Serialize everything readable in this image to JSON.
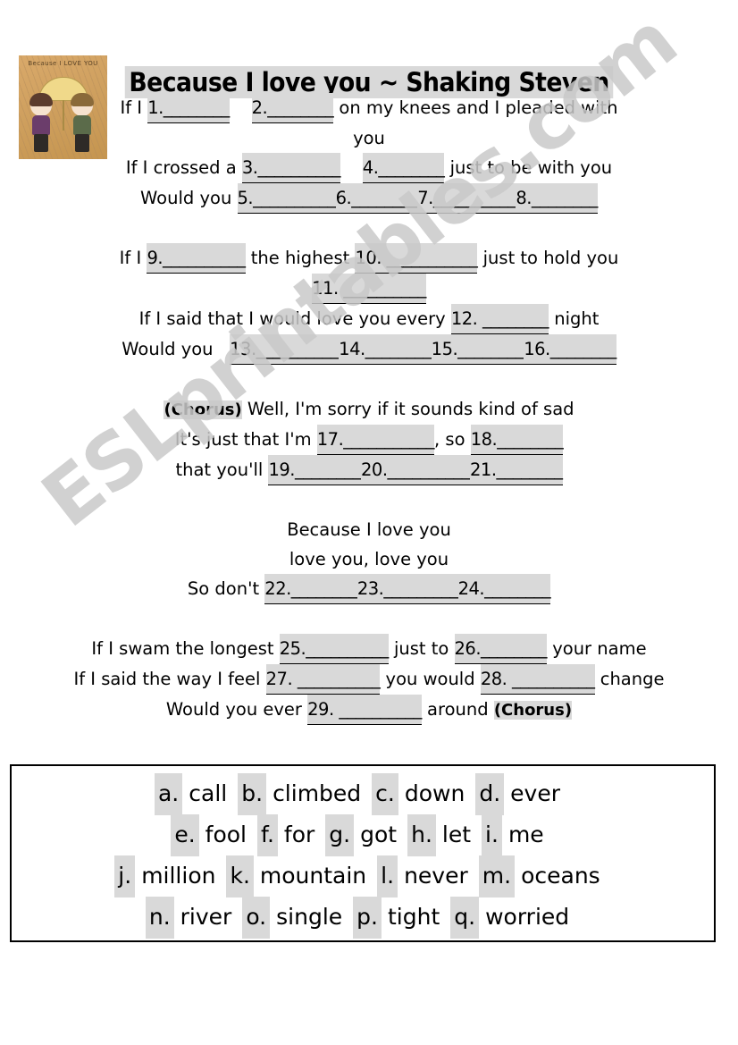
{
  "worksheet": {
    "title": "Because I love you ~ Shaking Steven",
    "cover_caption": "Because I LOVE YOU",
    "watermark": "ESLprintables.com"
  },
  "lyrics": {
    "verse1": {
      "line1_a": "If I ",
      "line1_b": "1.________",
      "line1_c": "2.________",
      "line1_d": " on my knees and I pleaded with",
      "line2": "you",
      "line3_a": "If I crossed a ",
      "line3_b": "3.__________",
      "line3_c": "4.________",
      "line3_d": " just to be with you",
      "line4_a": "Would you ",
      "line4_b": "5.__________",
      "line4_c": "6.________",
      "line4_d": "7.__________",
      "line4_e": "8.________"
    },
    "verse2": {
      "line1_a": "If I ",
      "line1_b": "9.__________",
      "line1_c": " the highest ",
      "line1_d": "10. ___________",
      "line1_e": " just to hold you",
      "line2": "11. __________",
      "line3_a": "If I said that I would love you every ",
      "line3_b": "12. ________",
      "line3_c": " night",
      "line4_a": "Would you ",
      "line4_b": "13.__________",
      "line4_c": "14.________",
      "line4_d": "15.________",
      "line4_e": "16.________"
    },
    "chorus": {
      "tag": "(Chorus)",
      "line1": " Well, I'm sorry if it sounds kind of sad",
      "line2_a": "It's just that I'm ",
      "line2_b": "17.___________",
      "line2_c": ", so ",
      "line2_d": "18.________",
      "line3_a": "that you'll ",
      "line3_b": "19.________",
      "line3_c": "20.__________",
      "line3_d": "21.________"
    },
    "refrain": {
      "line1": "Because I love you",
      "line2": "love you, love you",
      "line3_a": "So don't ",
      "line3_b": "22.________",
      "line3_c": "23._________",
      "line3_d": "24.________"
    },
    "verse3": {
      "line1_a": "If I swam the longest ",
      "line1_b": "25.__________",
      "line1_c": " just to ",
      "line1_d": "26.________",
      "line1_e": " your name",
      "line2_a": "If I said the way I feel ",
      "line2_b": "27. __________",
      "line2_c": " you would ",
      "line2_d": "28. __________",
      "line2_e": " change",
      "line3_a": "Would you ever ",
      "line3_b": "29. __________",
      "line3_c": " around ",
      "line3_d": "(Chorus)"
    }
  },
  "word_bank": {
    "rows": [
      [
        {
          "letter": "a.",
          "word": "call"
        },
        {
          "letter": "b.",
          "word": "climbed"
        },
        {
          "letter": "c.",
          "word": "down"
        },
        {
          "letter": "d.",
          "word": "ever"
        }
      ],
      [
        {
          "letter": "e.",
          "word": "fool"
        },
        {
          "letter": "f.",
          "word": "for"
        },
        {
          "letter": "g.",
          "word": "got"
        },
        {
          "letter": "h.",
          "word": "let"
        },
        {
          "letter": "i.",
          "word": "me"
        }
      ],
      [
        {
          "letter": "j.",
          "word": "million"
        },
        {
          "letter": "k.",
          "word": "mountain"
        },
        {
          "letter": "l.",
          "word": "never"
        },
        {
          "letter": "m.",
          "word": "oceans"
        }
      ],
      [
        {
          "letter": "n.",
          "word": "river"
        },
        {
          "letter": "o.",
          "word": "single"
        },
        {
          "letter": "p.",
          "word": "tight"
        },
        {
          "letter": "q.",
          "word": "worried"
        }
      ]
    ]
  },
  "colors": {
    "highlight": "#d9d9d9",
    "watermark": "#c9c9c9",
    "border": "#000000",
    "cover_bg": "#cfa05f"
  }
}
